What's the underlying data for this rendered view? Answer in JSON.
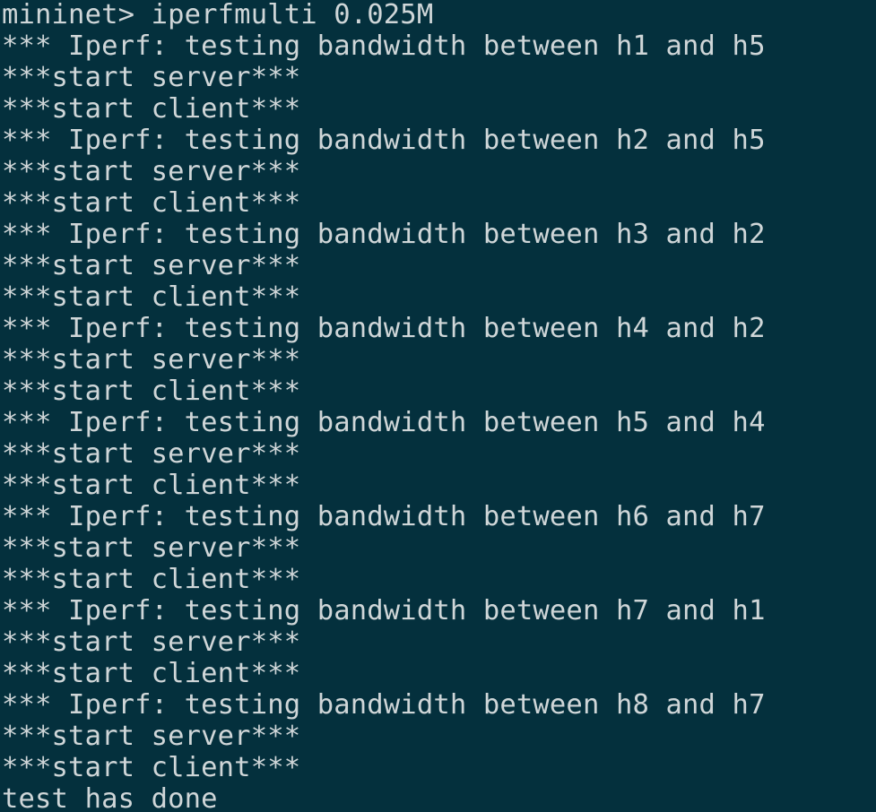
{
  "terminal": {
    "lines": [
      "mininet> iperfmulti 0.025M",
      "*** Iperf: testing bandwidth between h1 and h5",
      "***start server***",
      "***start client***",
      "*** Iperf: testing bandwidth between h2 and h5",
      "***start server***",
      "***start client***",
      "*** Iperf: testing bandwidth between h3 and h2",
      "***start server***",
      "***start client***",
      "*** Iperf: testing bandwidth between h4 and h2",
      "***start server***",
      "***start client***",
      "*** Iperf: testing bandwidth between h5 and h4",
      "***start server***",
      "***start client***",
      "*** Iperf: testing bandwidth between h6 and h7",
      "***start server***",
      "***start client***",
      "*** Iperf: testing bandwidth between h7 and h1",
      "***start server***",
      "***start client***",
      "*** Iperf: testing bandwidth between h8 and h7",
      "***start server***",
      "***start client***",
      "test has done"
    ],
    "colors": {
      "background": "#04303d",
      "foreground": "#cfd6d8"
    }
  }
}
